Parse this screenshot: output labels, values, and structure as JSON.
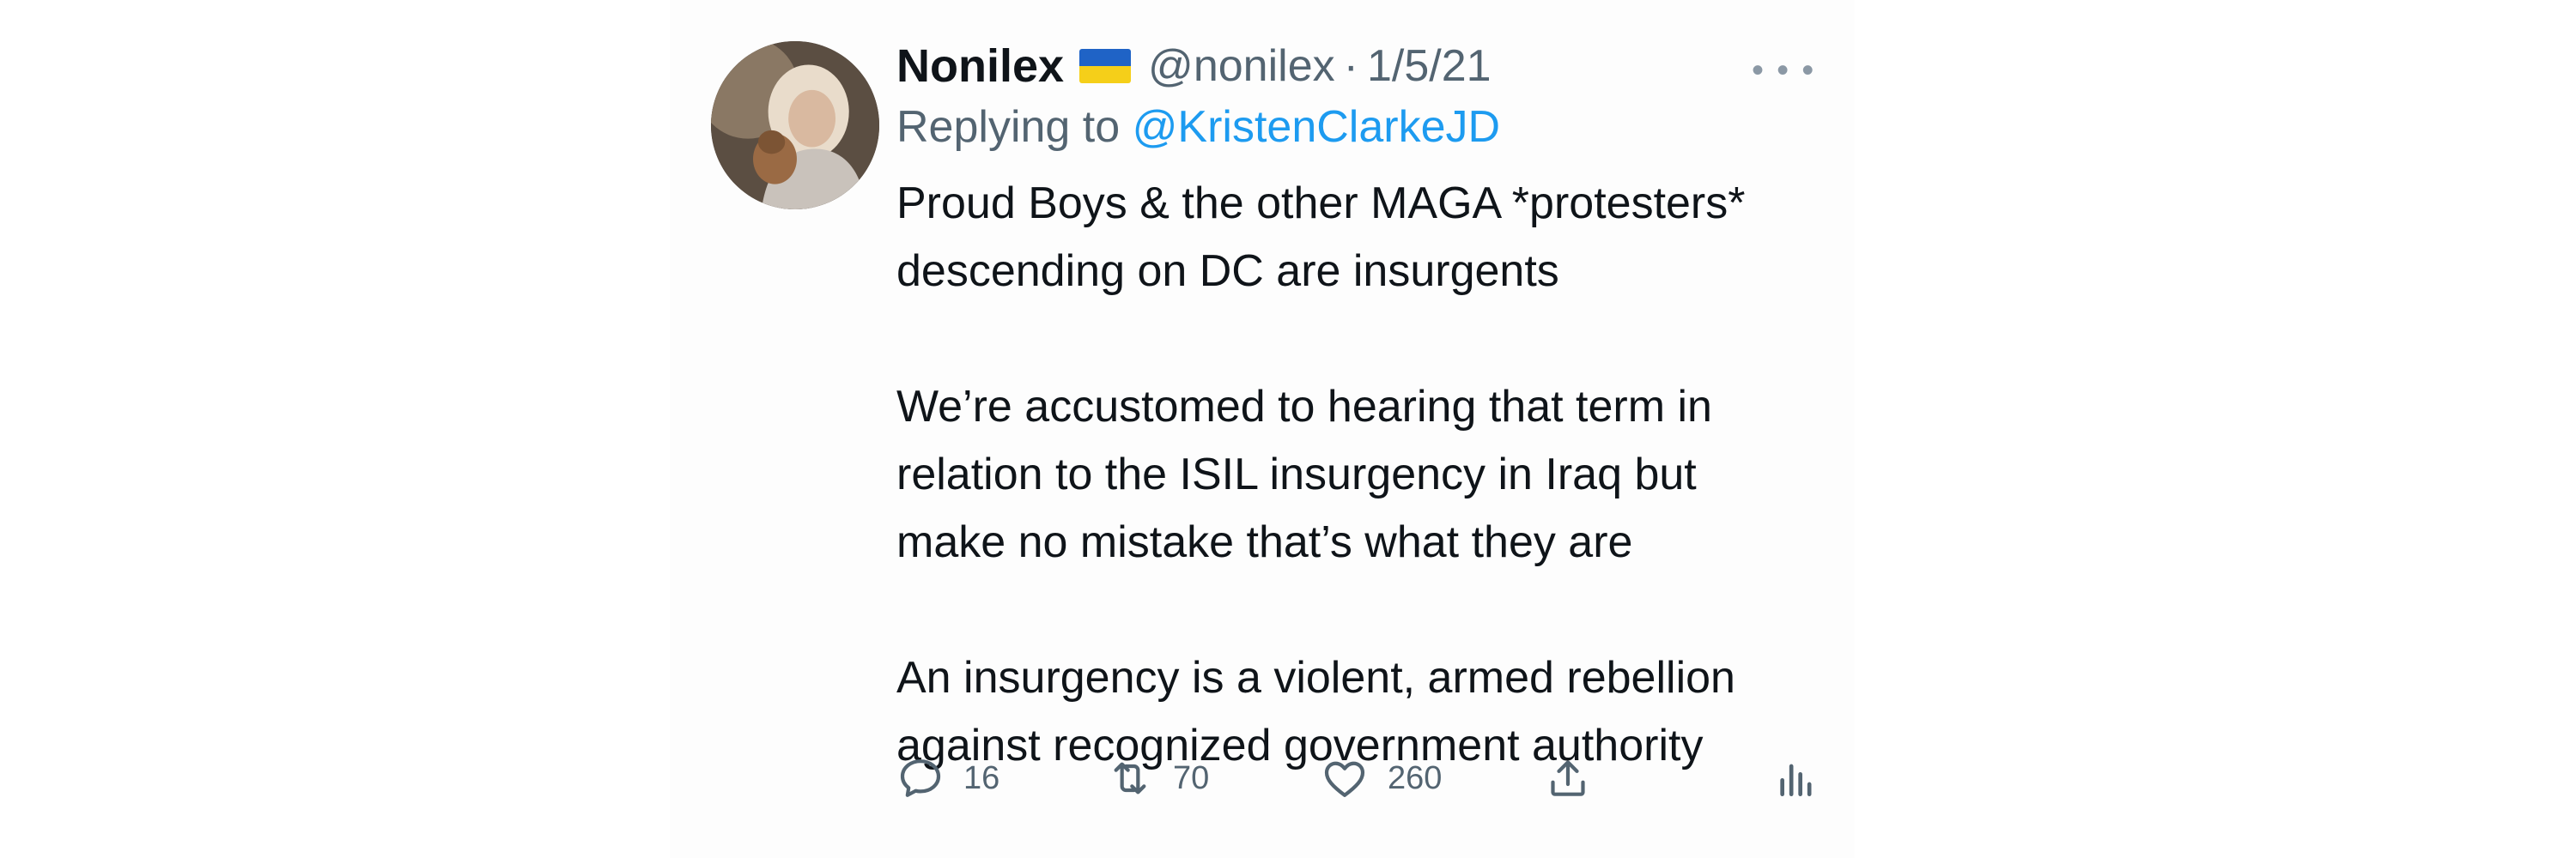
{
  "tweet": {
    "author_name": "Nonilex",
    "author_handle": "@nonilex",
    "separator": "·",
    "date": "1/5/21",
    "more_icon": "more-horizontal-icon",
    "replying_prefix": "Replying to",
    "replying_to": "@KristenClarkeJD",
    "paragraphs": [
      {
        "lines": [
          "Proud Boys & the other MAGA *protesters*",
          "descending on DC are insurgents"
        ]
      },
      {
        "lines": [
          "We’re accustomed to hearing that term in",
          "relation to the ISIL insurgency in Iraq but",
          "make no mistake that’s what they are"
        ]
      },
      {
        "lines": [
          "An insurgency is a violent, armed rebellion",
          "against recognized government authority"
        ]
      }
    ],
    "actions": {
      "reply": {
        "icon": "reply-icon",
        "count": "16"
      },
      "retweet": {
        "icon": "retweet-icon",
        "count": "70"
      },
      "like": {
        "icon": "heart-icon",
        "count": "260"
      },
      "share": {
        "icon": "share-icon"
      },
      "analytics": {
        "icon": "analytics-icon"
      }
    }
  },
  "colors": {
    "text": "#0f1419",
    "secondary": "#536471",
    "link": "#1d9bf0",
    "flag_blue": "#1f63c6",
    "flag_yellow": "#f5cf19"
  }
}
